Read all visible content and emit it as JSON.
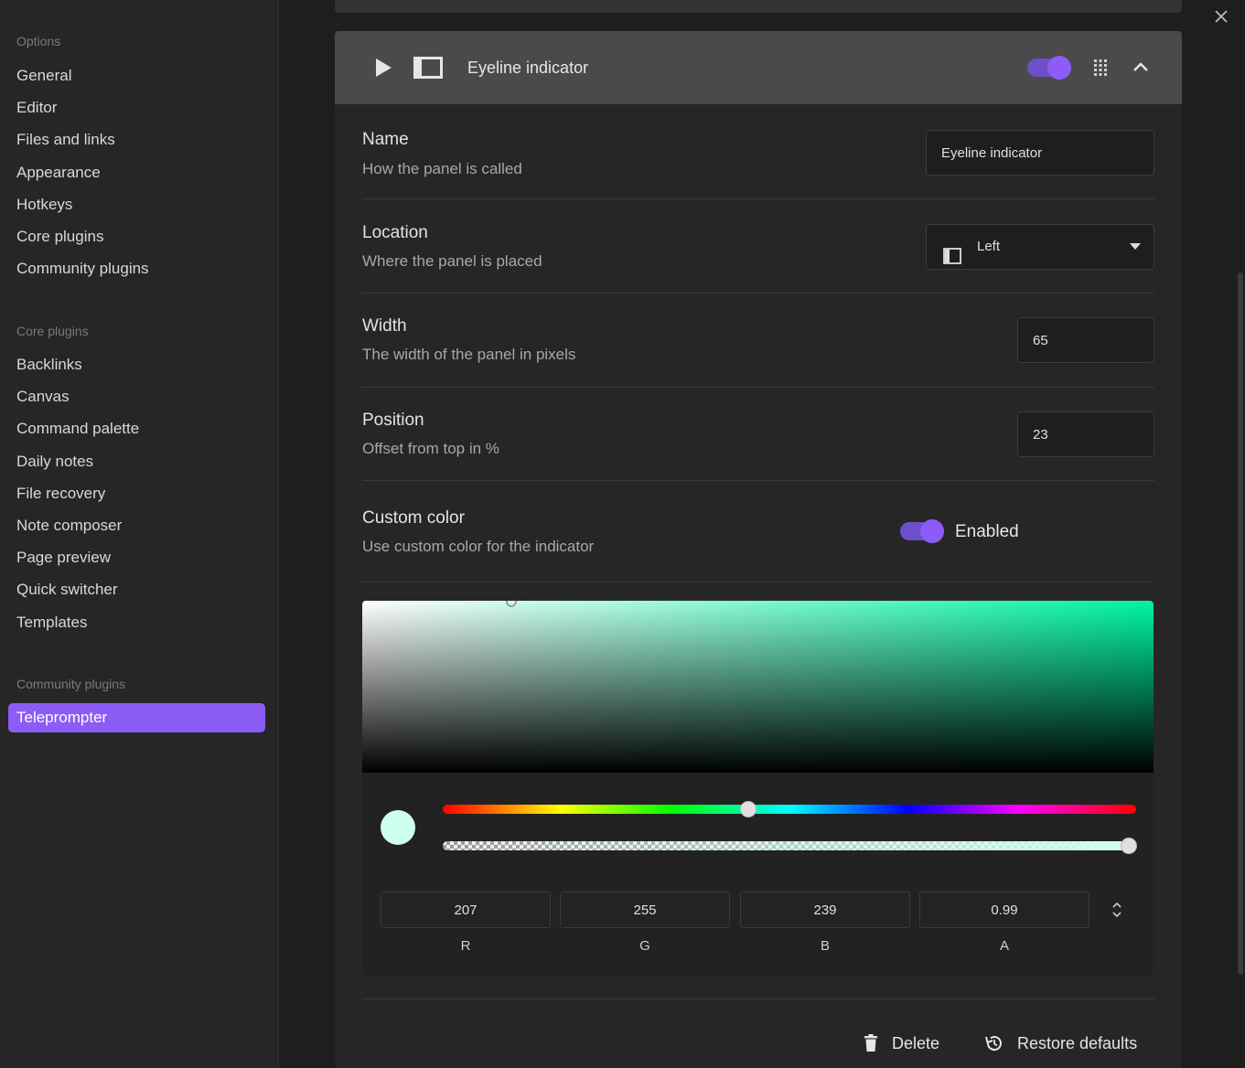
{
  "sidebar": {
    "options_title": "Options",
    "options_items": [
      "General",
      "Editor",
      "Files and links",
      "Appearance",
      "Hotkeys",
      "Core plugins",
      "Community plugins"
    ],
    "core_title": "Core plugins",
    "core_items": [
      "Backlinks",
      "Canvas",
      "Command palette",
      "Daily notes",
      "File recovery",
      "Note composer",
      "Page preview",
      "Quick switcher",
      "Templates"
    ],
    "community_title": "Community plugins",
    "community_items": [
      "Teleprompter"
    ],
    "active_item": "Teleprompter"
  },
  "window": {
    "close_icon": "close-icon"
  },
  "card": {
    "title": "Eyeline indicator",
    "enabled": true,
    "icons": [
      "play-icon",
      "panel-icon",
      "grip-icon",
      "chevron-up-icon"
    ]
  },
  "settings": {
    "name": {
      "label": "Name",
      "desc": "How the panel is called",
      "value": "Eyeline indicator"
    },
    "location": {
      "label": "Location",
      "desc": "Where the panel is placed",
      "value": "Left"
    },
    "width": {
      "label": "Width",
      "desc": "The width of the panel in pixels",
      "value": "65"
    },
    "position": {
      "label": "Position",
      "desc": "Offset from top in %",
      "value": "23"
    },
    "custom_color": {
      "label": "Custom color",
      "desc": "Use custom color for the indicator",
      "state_label": "Enabled",
      "enabled": true
    }
  },
  "color_picker": {
    "r": "207",
    "g": "255",
    "b": "239",
    "a": "0.99",
    "r_label": "R",
    "g_label": "G",
    "b_label": "B",
    "a_label": "A",
    "hue_fraction": 0.44,
    "alpha_fraction": 0.99,
    "preview_color": "#cfffef",
    "hue_color": "#00f5a0"
  },
  "footer": {
    "delete_label": "Delete",
    "restore_label": "Restore defaults"
  },
  "colors": {
    "accent": "#8b5cf6",
    "background": "#1e1e1e",
    "sidebar": "#262626"
  }
}
